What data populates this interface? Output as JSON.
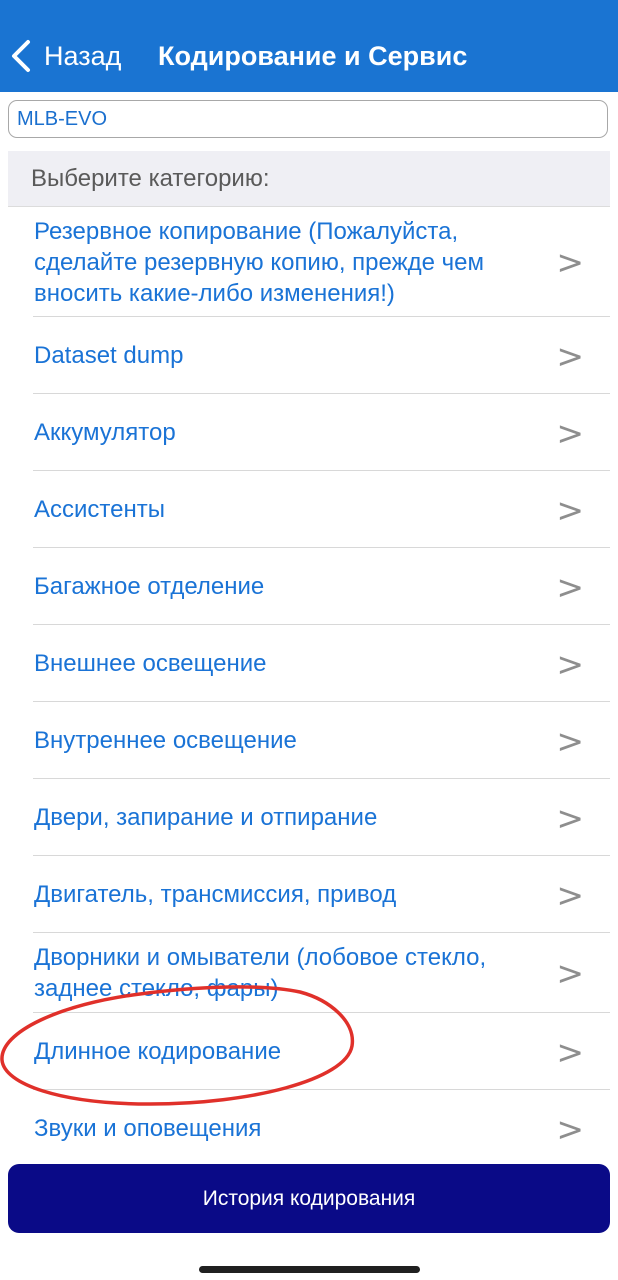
{
  "header": {
    "back_label": "Назад",
    "title": "Кодирование и Сервис",
    "background": "#1a74d2",
    "back_icon": "chevron-left-icon"
  },
  "model_field": {
    "value": "MLB-EVO"
  },
  "category_header": "Выберите категорию:",
  "categories": [
    {
      "label": "Резервное копирование (Пожалуйста, сделайте резервную копию, прежде чем вносить какие-либо изменения!)",
      "arrow": ">"
    },
    {
      "label": "Dataset dump",
      "arrow": ">"
    },
    {
      "label": "Аккумулятор",
      "arrow": ">"
    },
    {
      "label": "Ассистенты",
      "arrow": ">"
    },
    {
      "label": "Багажное отделение",
      "arrow": ">"
    },
    {
      "label": "Внешнее освещение",
      "arrow": ">"
    },
    {
      "label": "Внутреннее освещение",
      "arrow": ">"
    },
    {
      "label": "Двери, запирание и отпирание",
      "arrow": ">"
    },
    {
      "label": "Двигатель, трансмиссия, привод",
      "arrow": ">"
    },
    {
      "label": "Дворники и омыватели (лобовое стекло, заднее стекло, фары)",
      "arrow": ">"
    },
    {
      "label": "Длинное кодирование",
      "arrow": ">"
    },
    {
      "label": "Звуки и оповещения",
      "arrow": ">"
    }
  ],
  "history_button": {
    "label": "История кодирования",
    "background": "#0a0a87"
  },
  "colors": {
    "link_text": "#1a73d6",
    "annotation": "#e0302a"
  }
}
